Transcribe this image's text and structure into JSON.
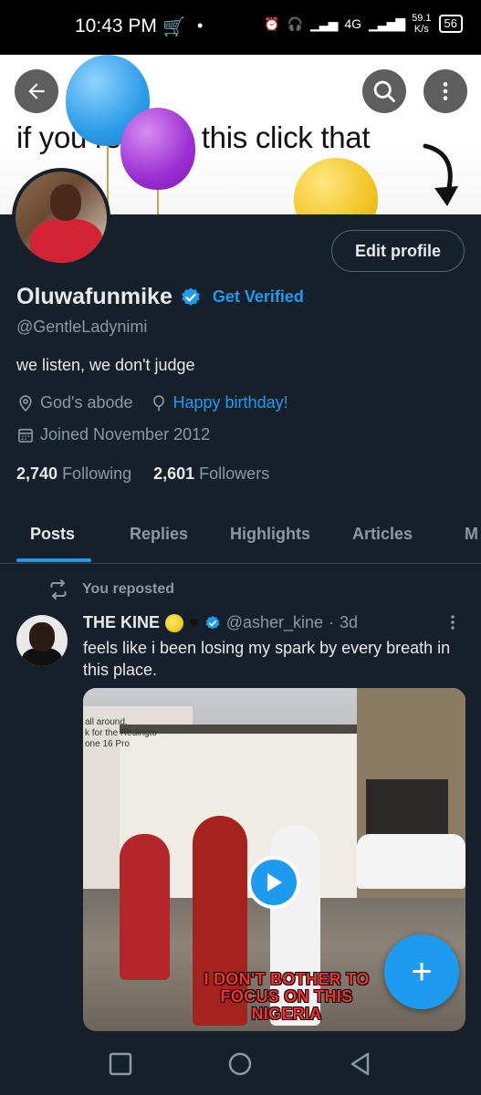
{
  "status_bar": {
    "time": "10:43 PM",
    "network_type": "4G",
    "speed_value": "59.1",
    "speed_unit": "K/s",
    "battery": "56"
  },
  "banner": {
    "caption": "if you reading this click that"
  },
  "profile": {
    "name": "Oluwafunmike",
    "get_verified_label": "Get Verified",
    "handle": "@GentleLadynimi",
    "bio": "we listen, we don't judge",
    "location": "God's abode",
    "birthday_link": "Happy birthday!",
    "joined": "Joined November 2012",
    "following_count": "2,740",
    "following_label": "Following",
    "followers_count": "2,601",
    "followers_label": "Followers",
    "edit_profile_label": "Edit profile"
  },
  "tabs": [
    {
      "label": "Posts",
      "active": true
    },
    {
      "label": "Replies",
      "active": false
    },
    {
      "label": "Highlights",
      "active": false
    },
    {
      "label": "Articles",
      "active": false
    },
    {
      "label": "M",
      "active": false
    }
  ],
  "post": {
    "repost_label": "You reposted",
    "author": "THE KINE",
    "handle": "@asher_kine",
    "time": "3d",
    "separator": "·",
    "text": "feels like i been losing my spark by every breath in this place.",
    "media_sign_text": "all around.\nk for the Redingto\none 16 Pro",
    "media_caption": "I DON'T BOTHER TO FOCUS ON THIS NIGERIA"
  },
  "fab_label": "+",
  "colors": {
    "background": "#15202b",
    "accent": "#1d9bf0",
    "muted_text": "#8b98a5",
    "text": "#e7e9ea"
  },
  "icons": {
    "back": "arrow-left-icon",
    "search": "search-icon",
    "more": "more-vertical-icon",
    "verified": "verified-badge-icon",
    "location": "location-pin-icon",
    "birthday": "balloon-icon",
    "calendar": "calendar-icon",
    "repost": "repost-icon",
    "play": "play-icon",
    "compose": "plus-icon"
  }
}
